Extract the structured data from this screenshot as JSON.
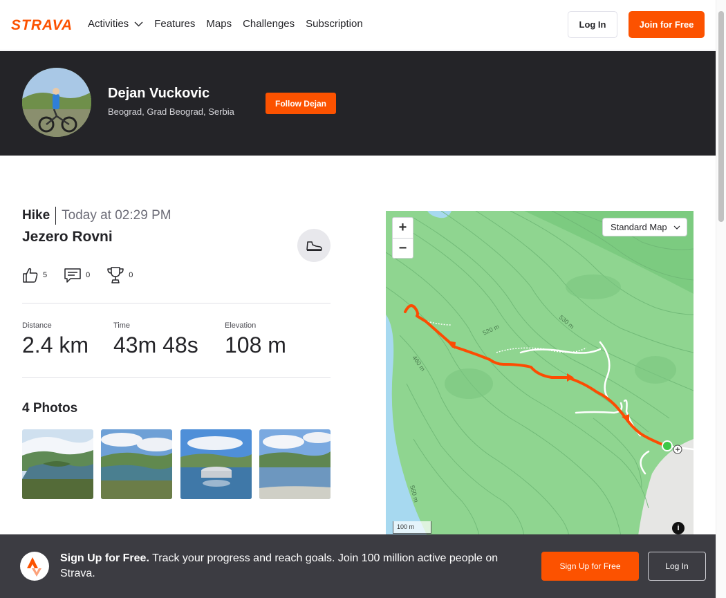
{
  "nav": {
    "logo_text": "STRAVA",
    "links": [
      "Activities",
      "Features",
      "Maps",
      "Challenges",
      "Subscription"
    ],
    "login": "Log In",
    "join": "Join for Free"
  },
  "athlete": {
    "name": "Dejan Vuckovic",
    "location": "Beograd, Grad Beograd, Serbia",
    "follow": "Follow Dejan"
  },
  "activity": {
    "type": "Hike",
    "date": "Today at 02:29 PM",
    "title": "Jezero Rovni",
    "kudos": "5",
    "comments": "0",
    "achievements": "0",
    "stats": [
      {
        "label": "Distance",
        "value": "2.4 km"
      },
      {
        "label": "Time",
        "value": "43m 48s"
      },
      {
        "label": "Elevation",
        "value": "108 m"
      }
    ],
    "photos_title": "4 Photos"
  },
  "map": {
    "style_select": "Standard Map",
    "zoom_in": "+",
    "zoom_out": "−",
    "scale": "100 m",
    "info": "i",
    "contours": [
      "520 m",
      "530 m",
      "460 m",
      "560 m"
    ]
  },
  "signup": {
    "bold": "Sign Up for Free.",
    "text": "Track your progress and reach goals. Join 100 million active people on Strava.",
    "signup_button": "Sign Up for Free",
    "login_button": "Log In"
  },
  "colors": {
    "brand": "#fc5200",
    "dark": "#242428",
    "route": "#fc4c02",
    "map_green": "#86d18a",
    "water": "#a7d9f0"
  }
}
